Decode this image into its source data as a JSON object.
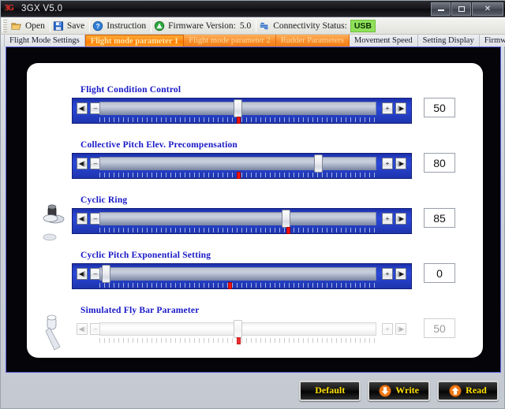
{
  "window": {
    "title": "3GX  V5.0",
    "logo": "3G",
    "minimize": "minimize-icon",
    "maximize": "maximize-icon",
    "close": "✕"
  },
  "toolbar": {
    "open_label": "Open",
    "save_label": "Save",
    "instruction_label": "Instruction",
    "firmware_label": "Firmware Version:",
    "firmware_value": "5.0",
    "connectivity_label": "Connectivity Status:",
    "connectivity_value": "USB"
  },
  "tabs": [
    {
      "label": "Flight Mode Settings",
      "state": "normal"
    },
    {
      "label": "Flight mode parameter 1",
      "state": "selected"
    },
    {
      "label": "Flight mode parameter 2",
      "state": "warm"
    },
    {
      "label": "Rudder Parameters",
      "state": "warm"
    },
    {
      "label": "Movement Speed",
      "state": "normal"
    },
    {
      "label": "Setting Display",
      "state": "normal"
    },
    {
      "label": "Firmwa",
      "state": "normal"
    }
  ],
  "tab_nav": {
    "prev": "◀",
    "next": "▶"
  },
  "sliders": [
    {
      "label": "Flight Condition Control",
      "value": "50",
      "thumb_pct": 50,
      "mark_pct": 50,
      "enabled": true,
      "has_knob": false,
      "btn_first": "◀|",
      "btn_dec": "–",
      "btn_inc": "+",
      "btn_last": "|▶"
    },
    {
      "label": "Collective Pitch Elev. Precompensation",
      "value": "80",
      "thumb_pct": 80,
      "mark_pct": 50,
      "enabled": true,
      "has_knob": false,
      "btn_first": "◀|",
      "btn_dec": "–",
      "btn_inc": "+",
      "btn_last": "|▶"
    },
    {
      "label": "Cyclic Ring",
      "value": "85",
      "thumb_pct": 68,
      "mark_pct": 68,
      "enabled": true,
      "has_knob": true,
      "btn_first": "◀|",
      "btn_dec": "–",
      "btn_inc": "+",
      "btn_last": "|▶"
    },
    {
      "label": "Cyclic Pitch Exponential Setting",
      "value": "0",
      "thumb_pct": 1,
      "mark_pct": 47,
      "enabled": true,
      "has_knob": false,
      "btn_first": "◀|",
      "btn_dec": "–",
      "btn_inc": "+",
      "btn_last": "|▶"
    },
    {
      "label": "Simulated Fly Bar Parameter",
      "value": "50",
      "thumb_pct": 50,
      "mark_pct": 50,
      "enabled": false,
      "has_knob": true,
      "btn_first": "◀|",
      "btn_dec": "–",
      "btn_inc": "+",
      "btn_last": "|▶"
    }
  ],
  "footer": {
    "default_label": "Default",
    "write_label": "Write",
    "read_label": "Read"
  },
  "colors": {
    "accent_blue": "#2540c8",
    "label_blue": "#1818c8",
    "tab_orange": "#ff8c1a",
    "usb_green": "#8fe05a",
    "button_yellow": "#ffe000",
    "marker_red": "#ee1111"
  }
}
